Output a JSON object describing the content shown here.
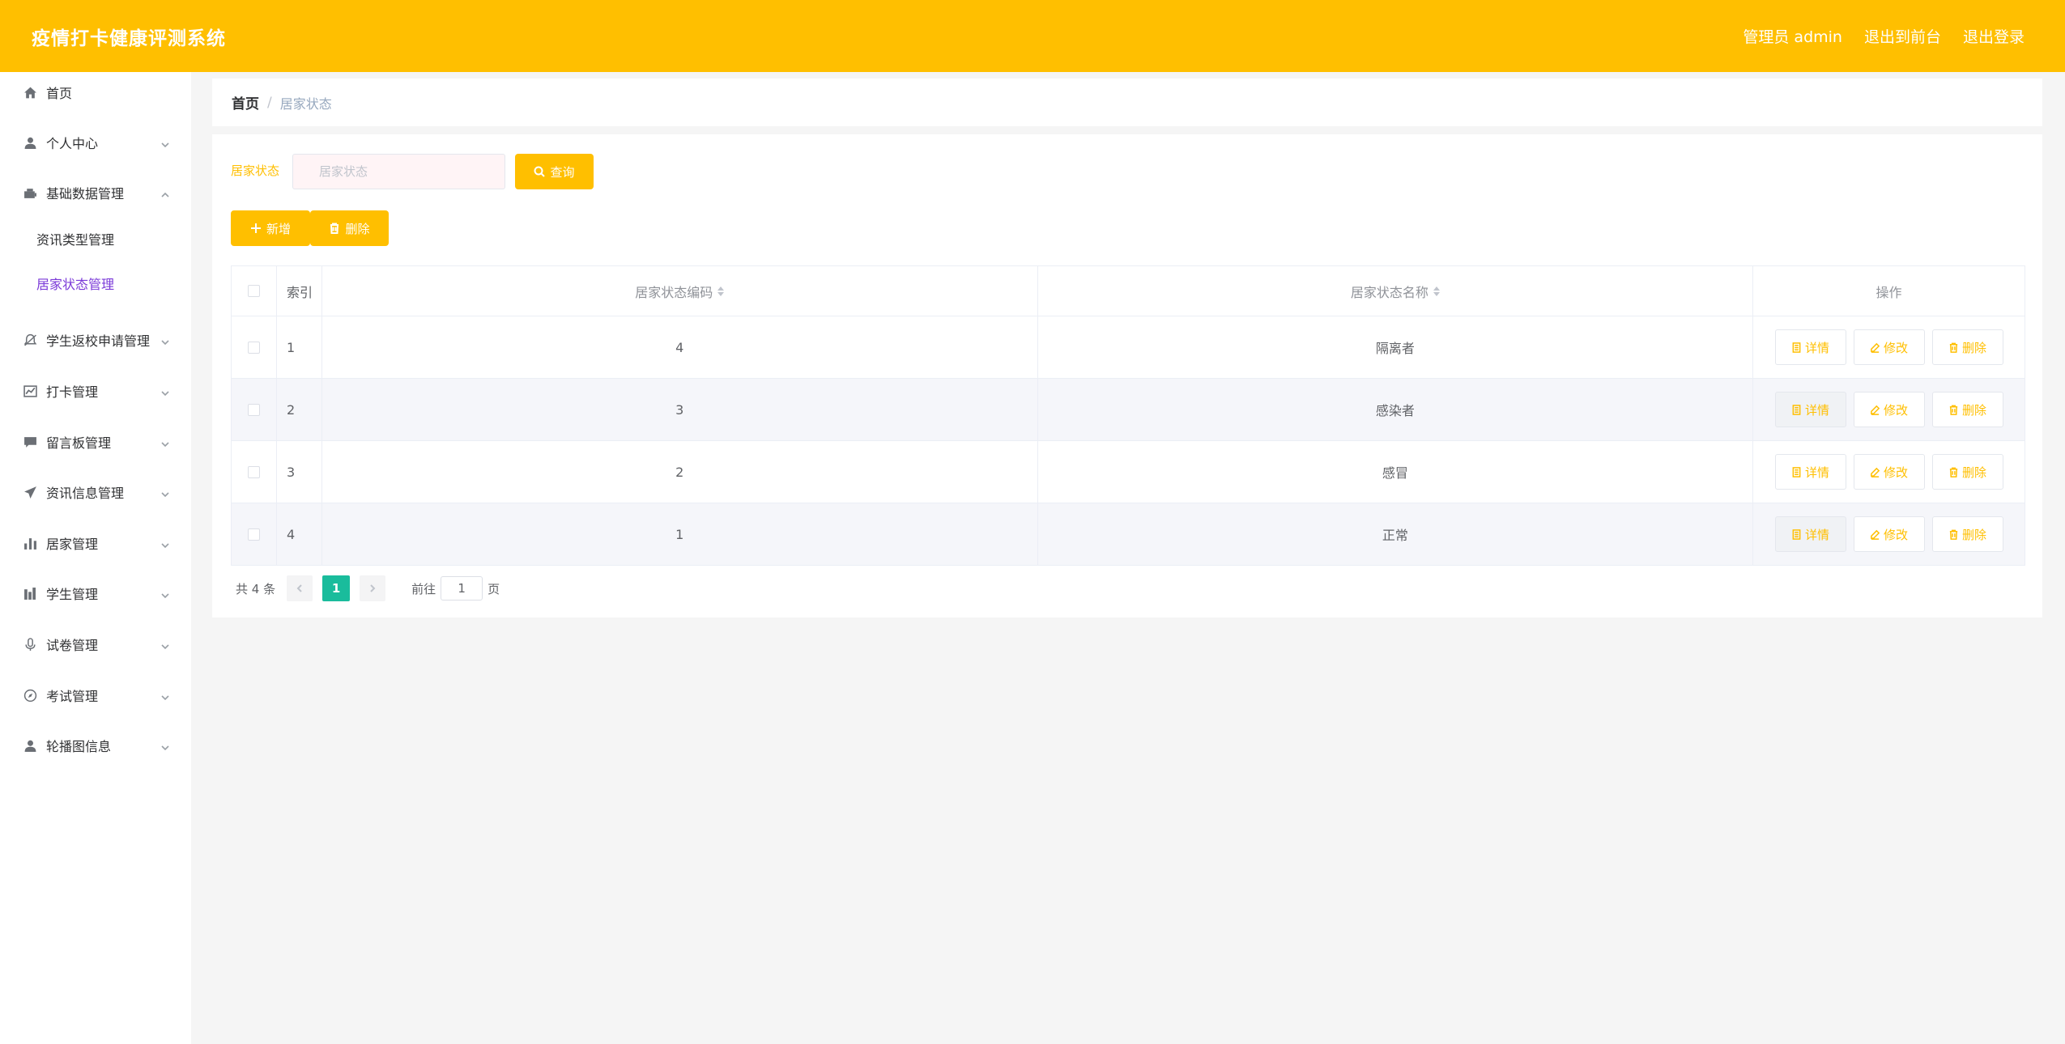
{
  "header": {
    "title": "疫情打卡健康评测系统",
    "user_label": "管理员 admin",
    "exit_front_label": "退出到前台",
    "logout_label": "退出登录"
  },
  "sidebar": {
    "items": [
      {
        "label": "首页",
        "icon": "home-icon"
      },
      {
        "label": "个人中心",
        "icon": "user-icon"
      },
      {
        "label": "基础数据管理",
        "icon": "toolbox-icon",
        "expanded": true,
        "children": [
          {
            "label": "资讯类型管理"
          },
          {
            "label": "居家状态管理",
            "active": true
          }
        ]
      },
      {
        "label": "学生返校申请管理",
        "icon": "bell-off-icon"
      },
      {
        "label": "打卡管理",
        "icon": "trend-chart-icon"
      },
      {
        "label": "留言板管理",
        "icon": "message-icon"
      },
      {
        "label": "资讯信息管理",
        "icon": "send-icon"
      },
      {
        "label": "居家管理",
        "icon": "bar-chart-icon"
      },
      {
        "label": "学生管理",
        "icon": "histogram-icon"
      },
      {
        "label": "试卷管理",
        "icon": "microphone-icon"
      },
      {
        "label": "考试管理",
        "icon": "compass-icon"
      },
      {
        "label": "轮播图信息",
        "icon": "avatar-icon"
      }
    ]
  },
  "breadcrumb": {
    "home": "首页",
    "separator": "/",
    "current": "居家状态"
  },
  "search": {
    "label": "居家状态",
    "placeholder": "居家状态",
    "value": "",
    "query_label": "查询"
  },
  "toolbar": {
    "add_label": "新增",
    "delete_label": "删除"
  },
  "table": {
    "columns": [
      "索引",
      "居家状态编码",
      "居家状态名称",
      "操作"
    ],
    "rows": [
      {
        "index": "1",
        "code": "4",
        "name": "隔离者"
      },
      {
        "index": "2",
        "code": "3",
        "name": "感染者"
      },
      {
        "index": "3",
        "code": "2",
        "name": "感冒"
      },
      {
        "index": "4",
        "code": "1",
        "name": "正常"
      }
    ],
    "actions": {
      "detail": "详情",
      "edit": "修改",
      "delete": "删除"
    }
  },
  "pagination": {
    "total_text": "共 4 条",
    "current_page": "1",
    "goto_label": "前往",
    "goto_value": "1",
    "page_suffix": "页"
  },
  "colors": {
    "accent": "#ffbf00",
    "active_menu": "#7b3ad8",
    "page_active": "#1abc9c"
  }
}
